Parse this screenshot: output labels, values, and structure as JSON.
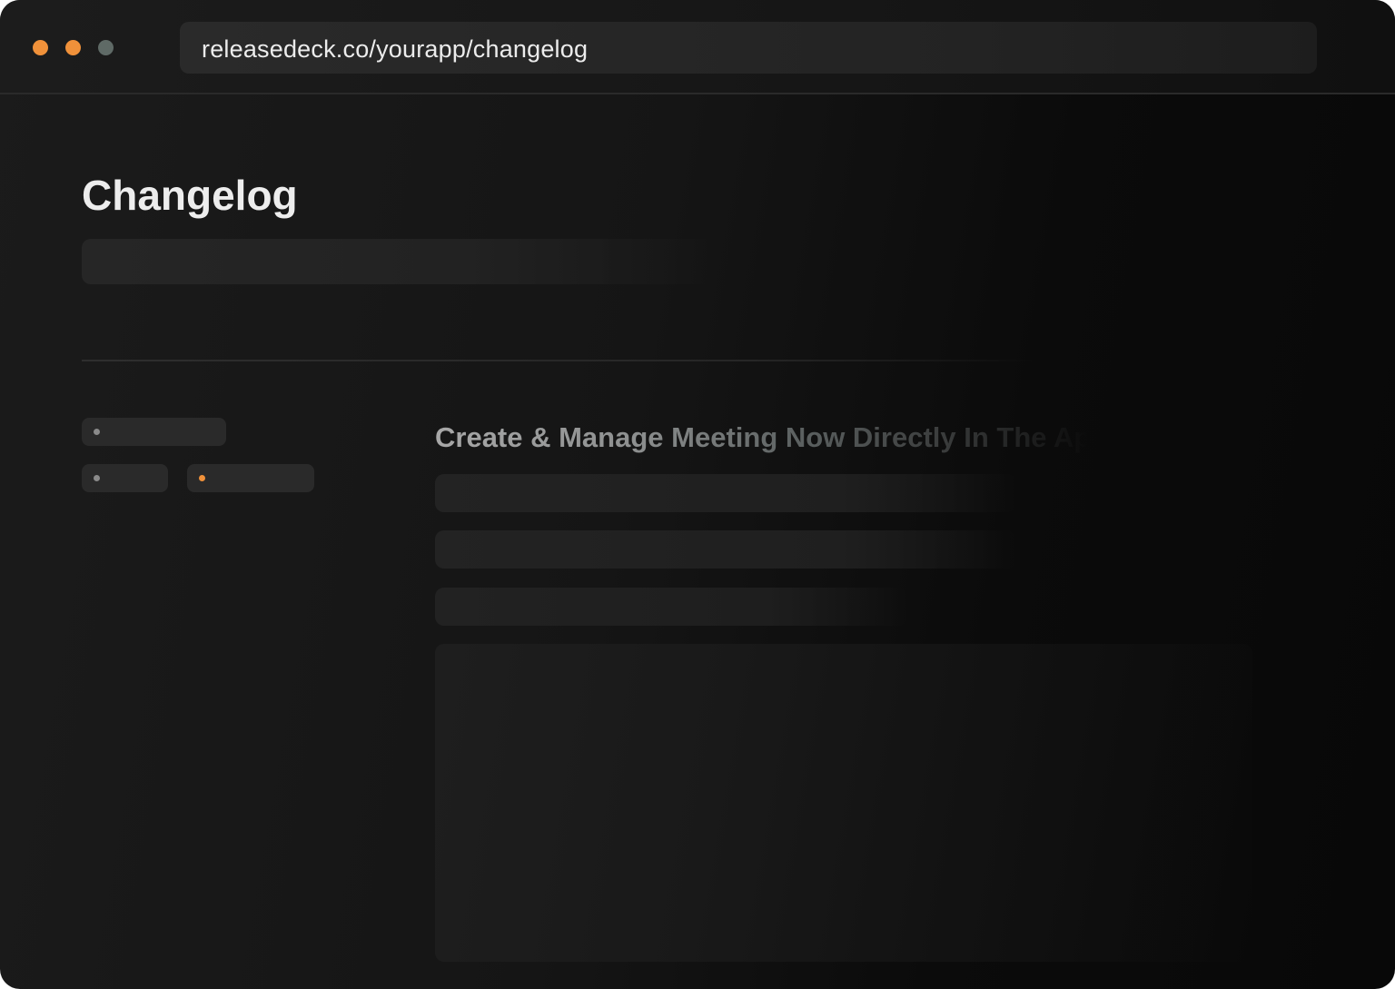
{
  "browser": {
    "url": "releasedeck.co/yourapp/changelog",
    "window_controls": [
      {
        "name": "close",
        "color": "#f0913a"
      },
      {
        "name": "minimize",
        "color": "#f0913a"
      },
      {
        "name": "maximize",
        "color": "#5f6a66"
      }
    ]
  },
  "page": {
    "title": "Changelog"
  },
  "filters": {
    "chips": [
      {
        "dot_color": "#8a8a8a"
      },
      {
        "dot_color": "#8a8a8a"
      },
      {
        "dot_color": "#f0913a"
      }
    ]
  },
  "entry": {
    "title": "Create & Manage Meeting Now Directly In The Ap"
  },
  "colors": {
    "accent": "#f0913a",
    "background": "#141414",
    "text": "#ededed"
  }
}
